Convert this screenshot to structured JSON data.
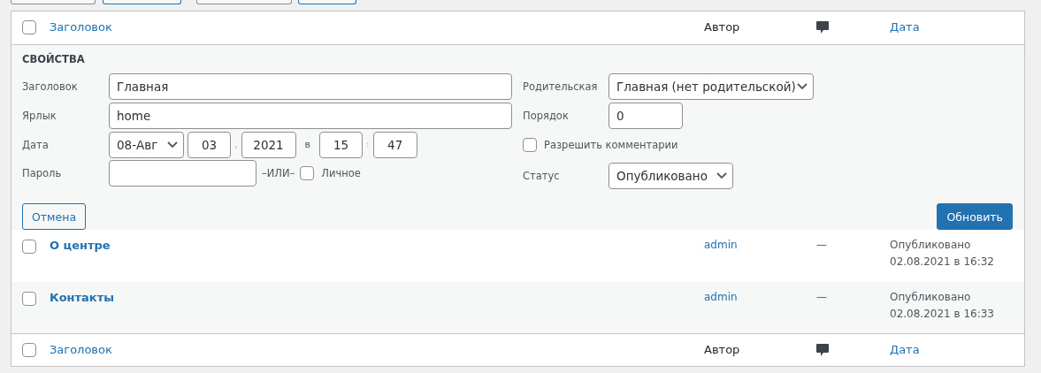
{
  "toolbar_buttons": [
    {
      "kind": "default"
    },
    {
      "kind": "primary"
    },
    {
      "kind": "default"
    },
    {
      "kind": "primary"
    }
  ],
  "header": {
    "checked": false,
    "columns": [
      {
        "kind": "link",
        "label": "Заголовок"
      },
      {
        "kind": "text",
        "label": "Автор"
      },
      {
        "kind": "comments-icon"
      },
      {
        "kind": "link",
        "label": "Дата"
      }
    ]
  },
  "quick_edit": {
    "heading": "СВОЙСТВА",
    "title": {
      "label": "Заголовок",
      "value": "Главная"
    },
    "slug": {
      "label": "Ярлык",
      "value": "home"
    },
    "date": {
      "label": "Дата",
      "month": "08-Авг",
      "day": "03",
      "sep1": ",",
      "year": "2021",
      "at": "в",
      "hour": "15",
      "sep3": ":",
      "minute": "47"
    },
    "password": {
      "label": "Пароль",
      "or": "–ИЛИ–",
      "private": {
        "label": "Личное",
        "checked": false
      }
    },
    "parent": {
      "label": "Родительская",
      "value": "Главная (нет родительской)"
    },
    "order": {
      "label": "Порядок",
      "value": "0"
    },
    "allow_comments": {
      "label": "Разрешить комментарии",
      "checked": false
    },
    "status": {
      "label": "Статус",
      "value": "Опубликовано"
    },
    "cancel": "Отмена",
    "update": "Обновить"
  },
  "rows": [
    {
      "checked": false,
      "title": "О центре",
      "author": "admin",
      "comments": "—",
      "status": "Опубликовано",
      "date": "02.08.2021 в 16:32"
    },
    {
      "checked": false,
      "title": "Контакты",
      "author": "admin",
      "comments": "—",
      "status": "Опубликовано",
      "date": "02.08.2021 в 16:33"
    }
  ],
  "footer": {
    "checked": false,
    "columns": [
      {
        "kind": "link",
        "label": "Заголовок"
      },
      {
        "kind": "text",
        "label": "Автор"
      },
      {
        "kind": "comments-icon"
      },
      {
        "kind": "link",
        "label": "Дата"
      }
    ]
  }
}
